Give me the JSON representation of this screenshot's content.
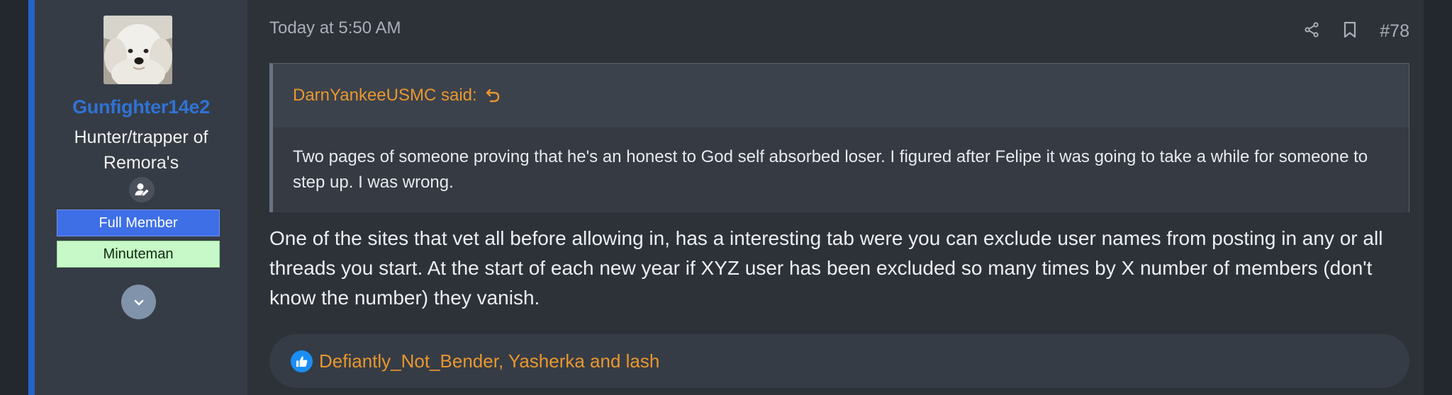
{
  "post": {
    "timestamp": "Today at 5:50 AM",
    "number": "#78",
    "share_icon": "share-icon",
    "bookmark_icon": "bookmark-icon"
  },
  "user": {
    "name": "Gunfighter14e2",
    "title": "Hunter/trapper of Remora's",
    "avatar": "avatar-white-dog",
    "badge_icon": "user-edit-icon",
    "banners": [
      "Full Member",
      "Minuteman"
    ],
    "expand_icon": "chevron-down-icon"
  },
  "quote": {
    "author_line": "DarnYankeeUSMC said:",
    "jump_icon": "reply-arrow-icon",
    "text": "Two pages of someone proving that he's an honest to God self absorbed loser. I figured after Felipe it was going to take a while for someone to step up. I was wrong."
  },
  "message": "One of the sites that vet all before allowing in, has a interesting tab were you can exclude user names from posting in any or all threads you start. At the start of each new year if XYZ user has been excluded so many times by X number of members (don't know the number) they vanish.",
  "reactions": {
    "icon": "thumbs-up-icon",
    "text": "Defiantly_Not_Bender, Yasherka and lash"
  },
  "colors": {
    "accent_blue": "#2463c6",
    "username": "#2f73d6",
    "link_orange": "#e8972f",
    "full_member": "#3e6fe6",
    "minuteman": "#c7f8c7"
  }
}
